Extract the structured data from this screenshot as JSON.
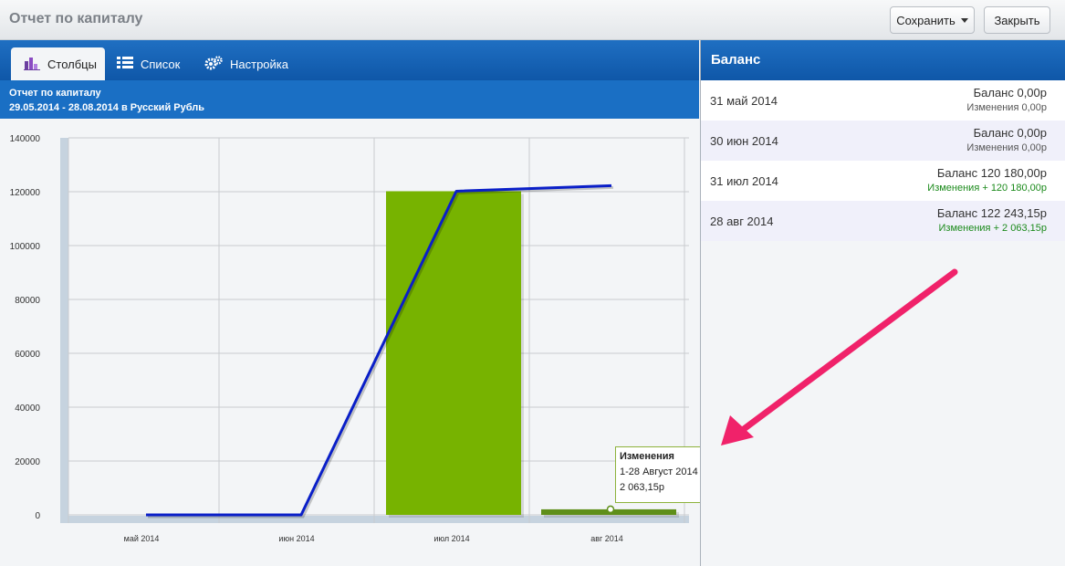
{
  "window": {
    "title": "Отчет по капиталу",
    "save_label": "Сохранить",
    "close_label": "Закрыть"
  },
  "tabs": [
    {
      "label": "Столбцы",
      "icon": "bar-chart-icon",
      "active": true
    },
    {
      "label": "Список",
      "icon": "list-icon",
      "active": false
    },
    {
      "label": "Настройка",
      "icon": "settings-gears-icon",
      "active": false
    }
  ],
  "report": {
    "title": "Отчет по капиталу",
    "subtitle": "29.05.2014 - 28.08.2014 в Русский Рубль"
  },
  "balance_panel": {
    "header": "Баланс",
    "rows": [
      {
        "date": "31 май 2014",
        "balance": "Баланс 0,00р",
        "change": "Изменения  0,00р",
        "positive": false
      },
      {
        "date": "30 июн 2014",
        "balance": "Баланс 0,00р",
        "change": "Изменения  0,00р",
        "positive": false
      },
      {
        "date": "31 июл 2014",
        "balance": "Баланс 120 180,00р",
        "change": "Изменения + 120 180,00р",
        "positive": true
      },
      {
        "date": "28 авг 2014",
        "balance": "Баланс 122 243,15р",
        "change": "Изменения + 2 063,15р",
        "positive": true
      }
    ]
  },
  "tooltip": {
    "title": "Изменения",
    "period": "1-28 Август 2014",
    "value": "2 063,15р"
  },
  "colors": {
    "bar": "#77b300",
    "bar_dark": "#5f8f1a",
    "line": "#0a1fc8",
    "accent_arrow": "#f0226a",
    "header_blue": "#1464b9"
  },
  "chart_data": {
    "type": "bar",
    "categories": [
      "май 2014",
      "июн 2014",
      "июл 2014",
      "авг 2014"
    ],
    "series": [
      {
        "type": "bar",
        "values": [
          0,
          0,
          120180,
          2063.15
        ]
      },
      {
        "type": "line",
        "values": [
          0,
          0,
          120180,
          122243.15
        ]
      }
    ],
    "y_ticks": [
      0,
      20000,
      40000,
      60000,
      80000,
      100000,
      120000,
      140000
    ],
    "ylim": [
      0,
      140000
    ],
    "grid": true
  }
}
